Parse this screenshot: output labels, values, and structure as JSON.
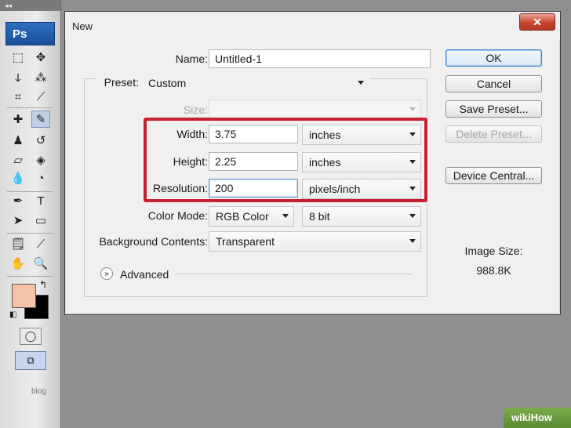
{
  "toolbar": {
    "logo": "Ps",
    "grip": "◂◂",
    "tools": [
      {
        "name": "rect-marquee-icon",
        "glyph": "⬚",
        "active": false
      },
      {
        "name": "move-icon",
        "glyph": "✥",
        "active": false
      },
      {
        "name": "lasso-icon",
        "glyph": "ↆ",
        "active": false
      },
      {
        "name": "magic-wand-icon",
        "glyph": "⁂",
        "active": false
      },
      {
        "name": "crop-icon",
        "glyph": "⌗",
        "active": false
      },
      {
        "name": "slice-icon",
        "glyph": "⟋",
        "active": false
      },
      {
        "name": "healing-brush-icon",
        "glyph": "✚",
        "active": false
      },
      {
        "name": "brush-icon",
        "glyph": "✎",
        "active": true
      },
      {
        "name": "clone-stamp-icon",
        "glyph": "♟",
        "active": false
      },
      {
        "name": "history-brush-icon",
        "glyph": "↺",
        "active": false
      },
      {
        "name": "eraser-icon",
        "glyph": "▱",
        "active": false
      },
      {
        "name": "paint-bucket-icon",
        "glyph": "◈",
        "active": false
      },
      {
        "name": "blur-icon",
        "glyph": "💧",
        "active": false
      },
      {
        "name": "dodge-icon",
        "glyph": "◔",
        "active": false
      },
      {
        "name": "pen-icon",
        "glyph": "✒",
        "active": false
      },
      {
        "name": "type-icon",
        "glyph": "T",
        "active": false
      },
      {
        "name": "path-select-icon",
        "glyph": "➤",
        "active": false
      },
      {
        "name": "shape-icon",
        "glyph": "▭",
        "active": false
      },
      {
        "name": "notes-icon",
        "glyph": "🗒",
        "active": false
      },
      {
        "name": "eyedropper-icon",
        "glyph": "⟋",
        "active": false
      },
      {
        "name": "hand-icon",
        "glyph": "✋",
        "active": false
      },
      {
        "name": "zoom-icon",
        "glyph": "🔍",
        "active": false
      }
    ],
    "swap_icon": "↰",
    "default_colors_icon": "◧",
    "quickmask_icon": "◯",
    "screenmode_icon": "⧉",
    "colors": {
      "foreground": "#f4c2a6",
      "background": "#000000"
    },
    "footer_text": "blog"
  },
  "dialog": {
    "title": "New",
    "close_label": "✕",
    "name_label": "Name:",
    "name_value": "Untitled-1",
    "preset_label": "Preset:",
    "preset_value": "Custom",
    "size_label": "Size:",
    "size_value": "",
    "width_label": "Width:",
    "width_value": "3.75",
    "width_unit": "inches",
    "height_label": "Height:",
    "height_value": "2.25",
    "height_unit": "inches",
    "resolution_label": "Resolution:",
    "resolution_value": "200",
    "resolution_unit": "pixels/inch",
    "color_mode_label": "Color Mode:",
    "color_mode_value": "RGB Color",
    "bit_depth_value": "8 bit",
    "bg_contents_label": "Background Contents:",
    "bg_contents_value": "Transparent",
    "advanced_label": "Advanced",
    "advanced_icon": "»",
    "buttons": {
      "ok": "OK",
      "cancel": "Cancel",
      "save_preset": "Save Preset...",
      "delete_preset": "Delete Preset...",
      "device_central": "Device Central..."
    },
    "image_size_label": "Image Size:",
    "image_size_value": "988.8K",
    "highlight_color": "#c8202e"
  },
  "watermark": "wikiHow"
}
